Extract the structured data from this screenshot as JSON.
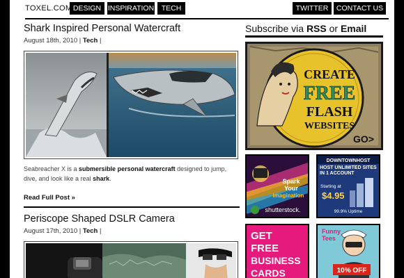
{
  "site": {
    "brand": "TOXEL.COM"
  },
  "nav": {
    "design": "DESIGN",
    "inspiration": "INSPIRATION",
    "tech": "TECH",
    "twitter": "TWITTER",
    "contact": "CONTACT US"
  },
  "posts": [
    {
      "title": "Shark Inspired Personal Watercraft",
      "date": "August 18th, 2010",
      "category": "Tech",
      "excerpt_prefix": "Seabreacher X is a ",
      "excerpt_bold1": "submersible personal watercraft",
      "excerpt_mid": " designed to jump, dive, and look like a real ",
      "excerpt_bold2": "shark",
      "excerpt_suffix": ".",
      "read_more": "Read Full Post »"
    },
    {
      "title": "Periscope Shaped DSLR Camera",
      "date": "August 17th, 2010",
      "category": "Tech"
    }
  ],
  "meta_separator": " | ",
  "sidebar": {
    "subscribe_prefix": "Subscribe via ",
    "subscribe_rss": "RSS",
    "subscribe_or": " or ",
    "subscribe_email": "Email",
    "badge_ad": {
      "line1": "CREATE",
      "line2": "FREE",
      "line3": "FLASH",
      "line4": "WEBSITES",
      "go": "GO>"
    },
    "ads": [
      {
        "line1": "Spark",
        "line2": "Your",
        "line3": "Imagination",
        "brand": "shutterstock."
      },
      {
        "brand": "DOWNTOWNHOST",
        "headline": "HOST UNLIMITED SITES IN 1 ACCOUNT",
        "starting": "Starting at",
        "price": "$4.95",
        "uptime": "99.9% Uptime"
      },
      {
        "line1": "GET",
        "line2": "FREE",
        "line3": "BUSINESS",
        "line4": "CARDS"
      },
      {
        "line1": "Funny",
        "line2": "Tees",
        "offer": "10% OFF"
      }
    ]
  },
  "colors": {
    "accent": "#000000",
    "badge_yellow": "#e8c22a",
    "pink": "#e6197c",
    "host_blue": "#1f3a7a"
  }
}
